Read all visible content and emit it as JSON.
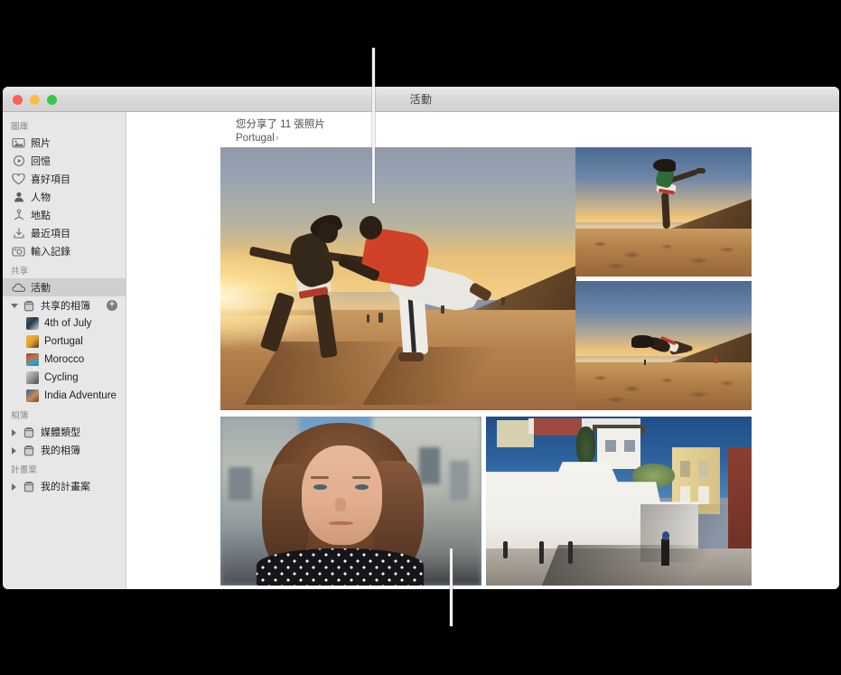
{
  "window": {
    "title": "活動",
    "traffic_lights": {
      "close": "close-button",
      "minimize": "minimize-button",
      "zoom": "zoom-button"
    }
  },
  "sidebar": {
    "sections": [
      {
        "heading": "圖庫",
        "items": [
          {
            "label": "照片",
            "icon": "photos-icon",
            "selected": false
          },
          {
            "label": "回憶",
            "icon": "memories-icon",
            "selected": false
          },
          {
            "label": "喜好項目",
            "icon": "heart-icon",
            "selected": false
          },
          {
            "label": "人物",
            "icon": "person-icon",
            "selected": false
          },
          {
            "label": "地點",
            "icon": "places-pin-icon",
            "selected": false
          },
          {
            "label": "最近項目",
            "icon": "recents-download-icon",
            "selected": false
          },
          {
            "label": "輸入記錄",
            "icon": "import-camera-icon",
            "selected": false
          }
        ]
      },
      {
        "heading": "共享",
        "items": [
          {
            "label": "活動",
            "icon": "cloud-icon",
            "selected": true
          }
        ],
        "group": {
          "label": "共享的相簿",
          "icon": "shared-albums-icon",
          "expanded": true,
          "add_button": "+",
          "albums": [
            {
              "label": "4th of July",
              "thumb": "thumb-4th-of-july"
            },
            {
              "label": "Portugal",
              "thumb": "thumb-portugal"
            },
            {
              "label": "Morocco",
              "thumb": "thumb-morocco"
            },
            {
              "label": "Cycling",
              "thumb": "thumb-cycling"
            },
            {
              "label": "India Adventure",
              "thumb": "thumb-india-adventure"
            }
          ]
        }
      },
      {
        "heading": "相簿",
        "folders": [
          {
            "label": "媒體類型",
            "icon": "folder-icon",
            "expanded": false
          },
          {
            "label": "我的相簿",
            "icon": "folder-icon",
            "expanded": false
          }
        ]
      },
      {
        "heading": "計畫案",
        "folders": [
          {
            "label": "我的計畫案",
            "icon": "folder-icon",
            "expanded": false
          }
        ]
      }
    ]
  },
  "content": {
    "share_header": {
      "line1": "您分享了 11 張照片",
      "album_link": "Portugal",
      "chevron": "›"
    },
    "photos": [
      {
        "name": "photo-beach-pair",
        "alt": "兩人在日落沙灘上跳舞"
      },
      {
        "name": "photo-jump-kick",
        "alt": "沙灘上跳躍踢腿的人"
      },
      {
        "name": "photo-jump-flip",
        "alt": "沙灘上空翻的人"
      },
      {
        "name": "photo-portrait",
        "alt": "街道上的女子肖像"
      },
      {
        "name": "photo-street",
        "alt": "白色圍牆的街道"
      }
    ]
  },
  "annotations": {
    "callout_top": "callout-line-top",
    "callout_bottom": "callout-line-bottom"
  },
  "colors": {
    "window_chrome": "#d8d8d8",
    "sidebar_bg": "#e7e7e7",
    "selected_row": "#cfcfcf",
    "traffic_red": "#fc6058",
    "traffic_yellow": "#fdbc40",
    "traffic_green": "#34c749",
    "callout": "#f4f4f4",
    "backdrop": "#000000"
  }
}
